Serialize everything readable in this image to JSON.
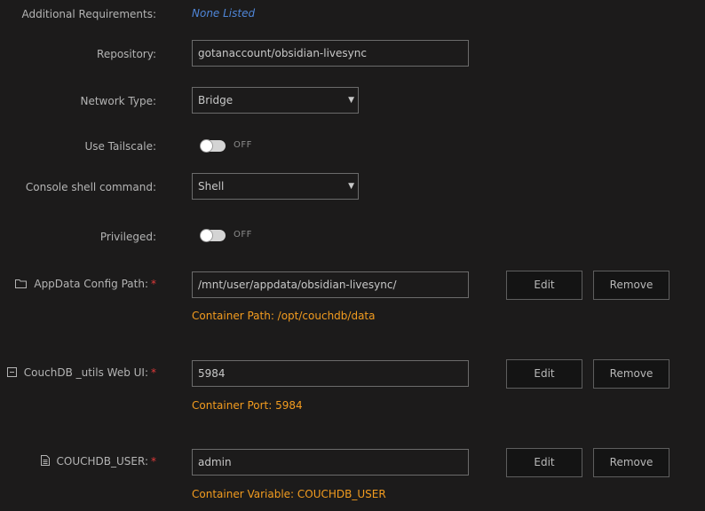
{
  "additional_requirements": {
    "label": "Additional Requirements:",
    "value": "None Listed"
  },
  "repository": {
    "label": "Repository:",
    "value": "gotanaccount/obsidian-livesync"
  },
  "network_type": {
    "label": "Network Type:",
    "value": "Bridge"
  },
  "use_tailscale": {
    "label": "Use Tailscale:",
    "state": "OFF"
  },
  "console_shell": {
    "label": "Console shell command:",
    "value": "Shell"
  },
  "privileged": {
    "label": "Privileged:",
    "state": "OFF"
  },
  "appdata_path": {
    "label": "AppData Config Path:",
    "icon": "folder-icon",
    "value": "/mnt/user/appdata/obsidian-livesync/",
    "hint": "Container Path: /opt/couchdb/data",
    "edit_label": "Edit",
    "remove_label": "Remove"
  },
  "web_ui": {
    "label": "CouchDB _utils Web UI:",
    "icon": "port-icon",
    "value": "5984",
    "hint": "Container Port: 5984",
    "edit_label": "Edit",
    "remove_label": "Remove"
  },
  "couchdb_user": {
    "label": "COUCHDB_USER:",
    "icon": "variable-icon",
    "value": "admin",
    "hint": "Container Variable: COUCHDB_USER",
    "edit_label": "Edit",
    "remove_label": "Remove"
  },
  "required_marker": "*",
  "select_arrow": "▼",
  "colors": {
    "background": "#1c1b1b",
    "hint": "#f39c1f",
    "link": "#4f86d8",
    "required": "#e03a3a"
  }
}
